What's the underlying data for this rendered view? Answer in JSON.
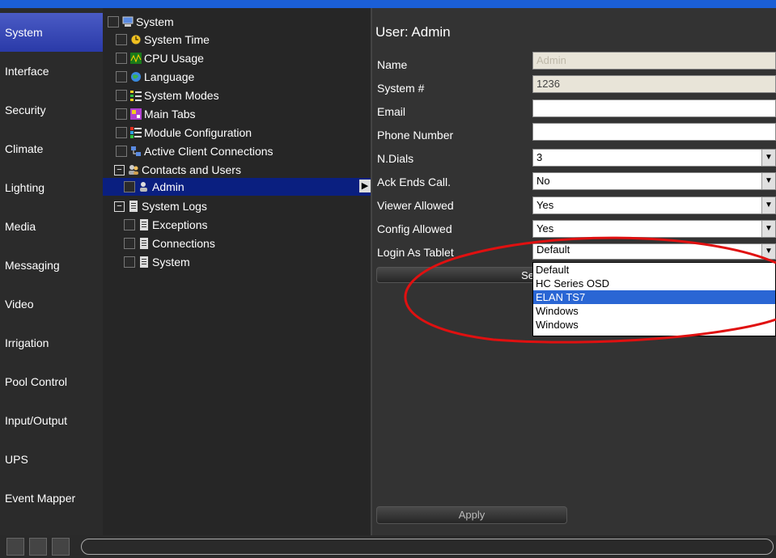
{
  "nav": {
    "items": [
      "System",
      "Interface",
      "Security",
      "Climate",
      "Lighting",
      "Media",
      "Messaging",
      "Video",
      "Irrigation",
      "Pool Control",
      "Input/Output",
      "UPS",
      "Event Mapper"
    ],
    "active": "System"
  },
  "tree": {
    "root": "System",
    "items": {
      "system_time": "System Time",
      "cpu_usage": "CPU Usage",
      "language": "Language",
      "system_modes": "System Modes",
      "main_tabs": "Main Tabs",
      "module_configuration": "Module Configuration",
      "active_client_connections": "Active Client Connections",
      "contacts_and_users": "Contacts and Users",
      "admin": "Admin",
      "system_logs": "System Logs",
      "exceptions": "Exceptions",
      "connections": "Connections",
      "system_log": "System"
    }
  },
  "panel": {
    "title": "User: Admin",
    "labels": {
      "name": "Name",
      "system_num": "System #",
      "email": "Email",
      "phone": "Phone Number",
      "ndials": "N.Dials",
      "ack": "Ack Ends Call.",
      "viewer": "Viewer Allowed",
      "config": "Config Allowed",
      "login": "Login As Tablet"
    },
    "values": {
      "name_placeholder": "Admin",
      "system_num": "1236",
      "email": "",
      "phone": "",
      "ndials": "3",
      "ack": "No",
      "viewer": "Yes",
      "config": "Yes",
      "login": "Default"
    },
    "partial_button": "Se",
    "apply": "Apply"
  },
  "dropdown": {
    "options": [
      "Default",
      "HC Series OSD",
      "ELAN TS7",
      "Windows",
      "Windows"
    ],
    "highlighted": 2
  },
  "colors": {
    "accent": "#2a66d4",
    "nav_active": "#3a4bb8",
    "annotation": "#e01010"
  }
}
